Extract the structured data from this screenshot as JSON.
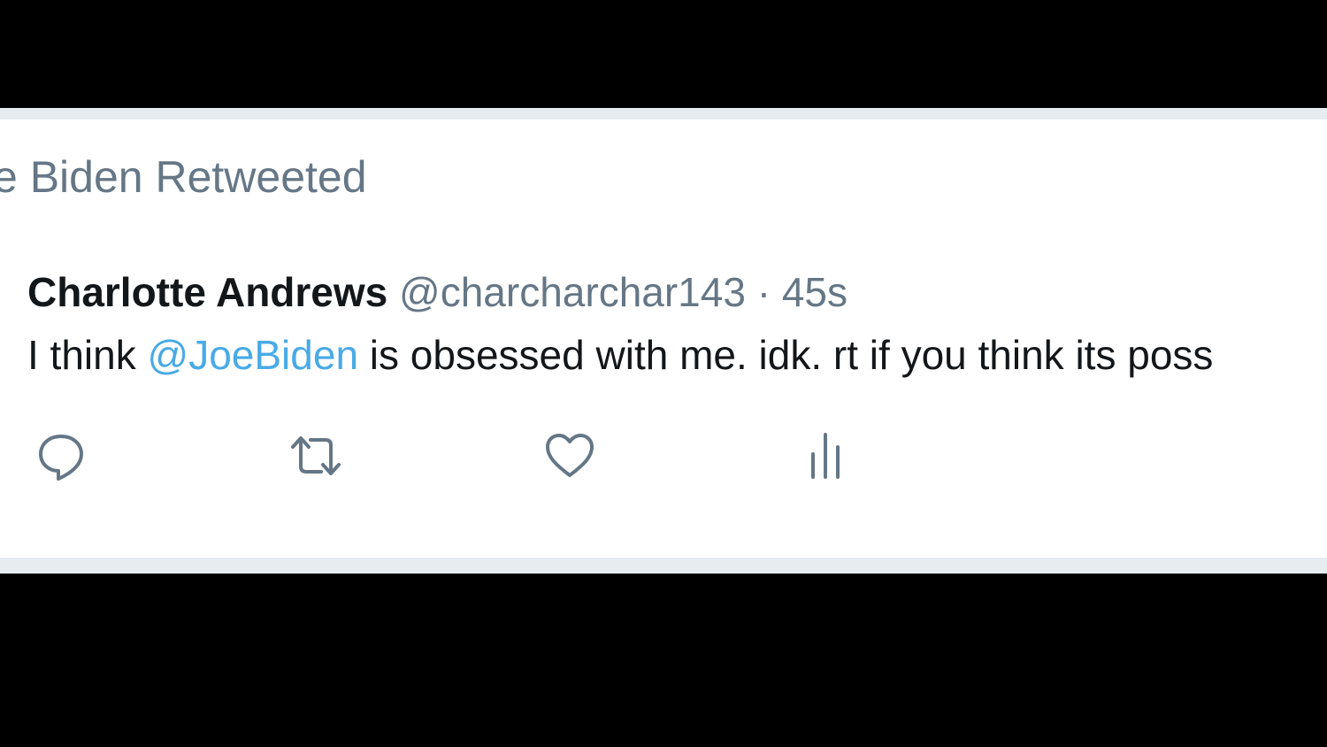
{
  "retweet_context": "e Biden Retweeted",
  "tweet": {
    "display_name": "Charlotte Andrews",
    "handle": "@charcharchar143",
    "separator": "·",
    "time": "45s",
    "text_before": "I think ",
    "mention": "@JoeBiden",
    "text_after": " is obsessed with me. idk. rt if you think its poss"
  },
  "actions": {
    "reply_icon": "reply-icon",
    "retweet_icon": "retweet-icon",
    "like_icon": "heart-icon",
    "analytics_icon": "analytics-icon"
  },
  "colors": {
    "text": "#14171a",
    "secondary": "#657786",
    "link": "#1b95e0",
    "border": "#e6ecf0",
    "background": "#000000"
  }
}
